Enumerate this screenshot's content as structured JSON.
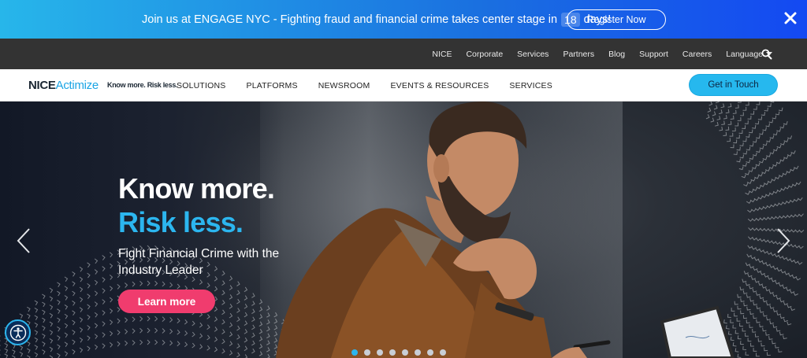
{
  "promo": {
    "text_before": "Join us at ENGAGE NYC - Fighting fraud and financial crime takes center stage in",
    "days": "18",
    "text_after": "days!",
    "register_label": "Register Now",
    "close_icon": "close-icon"
  },
  "utility_nav": {
    "links": [
      "NICE",
      "Corporate",
      "Services",
      "Partners",
      "Blog",
      "Support",
      "Careers",
      "Language"
    ],
    "search_icon": "search-icon"
  },
  "main_nav": {
    "logo_nice": "NICE",
    "logo_actimize": "Actimize",
    "tagline": "Know more. Risk less.",
    "menu": [
      "SOLUTIONS",
      "PLATFORMS",
      "NEWSROOM",
      "EVENTS & RESOURCES",
      "SERVICES"
    ],
    "cta_label": "Get in Touch"
  },
  "hero": {
    "title_line1": "Know more.",
    "title_line2": "Risk less.",
    "subtitle": "Fight Financial Crime with the Industry Leader",
    "button_label": "Learn more",
    "slide_count": 8,
    "active_slide": 1
  },
  "colors": {
    "accent": "#2cb6ef",
    "cta_pink": "#f03c6e",
    "utility_bg": "#333333",
    "banner_start": "#27b6ea",
    "banner_end": "#1449f2"
  }
}
